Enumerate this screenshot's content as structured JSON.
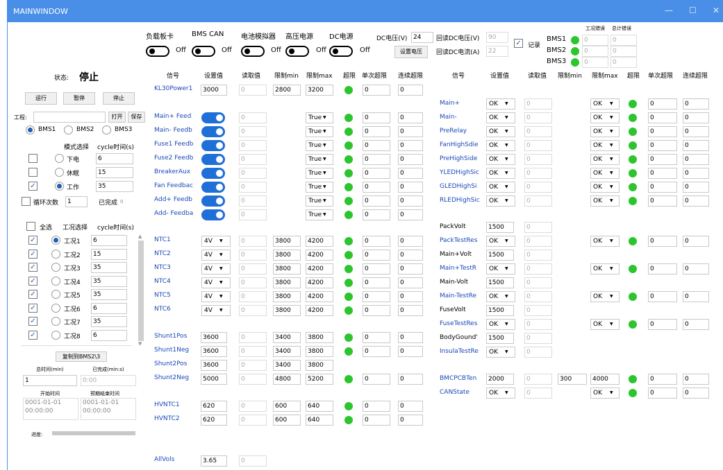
{
  "window": {
    "title": "MAINWINDOW"
  },
  "top": {
    "labels": [
      "负载板卡",
      "BMS CAN",
      "电池模拟器",
      "高压电源",
      "DC电源"
    ],
    "off": "Off",
    "dc_v_label": "DC电压(V)",
    "dc_v_value": "24",
    "set_btn": "设置电压",
    "rb_v_label": "回读DC电压(V)",
    "rb_v_value": "90",
    "rb_i_label": "回读DC电流(A)",
    "rb_i_value": "22",
    "record_label": "记录",
    "err_hdr1": "工况错误",
    "err_hdr2": "总计错误",
    "bms": [
      {
        "name": "BMS1",
        "a": "0",
        "b": "0"
      },
      {
        "name": "BMS2",
        "a": "0",
        "b": "0"
      },
      {
        "name": "BMS3",
        "a": "0",
        "b": "0"
      }
    ]
  },
  "left": {
    "status_label": "状态:",
    "status_value": "停止",
    "run": "运行",
    "pause": "暂停",
    "stop": "停止",
    "project_label": "工程:",
    "open": "打开",
    "save": "保存",
    "bms_options": [
      "BMS1",
      "BMS2",
      "BMS3"
    ],
    "mode_hdr": "模式选择",
    "cycle_hdr": "cycle时间(s)",
    "modes": [
      {
        "name": "下电",
        "val": "6"
      },
      {
        "name": "休眠",
        "val": "15"
      },
      {
        "name": "工作",
        "val": "35"
      }
    ],
    "loop_label": "循环次数",
    "loop_value": "1",
    "done_label": "已完成",
    "done_value": "0",
    "all_label": "全选",
    "cond_hdr": "工况选择",
    "cond_cycle_hdr": "cycle时间(s)",
    "conds": [
      {
        "name": "工况1",
        "val": "6"
      },
      {
        "name": "工况2",
        "val": "15"
      },
      {
        "name": "工况3",
        "val": "35"
      },
      {
        "name": "工况4",
        "val": "35"
      },
      {
        "name": "工况5",
        "val": "35"
      },
      {
        "name": "工况6",
        "val": "6"
      },
      {
        "name": "工况7",
        "val": "35"
      },
      {
        "name": "工况8",
        "val": "6"
      }
    ],
    "copy_btn": "复制到BMS2\\3",
    "total_time_label": "总时间(min)",
    "done_min_label": "已完成(min:s)",
    "total_time_value": "1",
    "done_min_value": "0:00",
    "start_label": "开始时间",
    "end_label": "预期结束时间",
    "start_value": "0001-01-01 00:00:00",
    "end_value": "0001-01-01 00:00:00",
    "progress_label": "进度:"
  },
  "mid": {
    "headers": [
      "信号",
      "设置值",
      "读取值",
      "限制min",
      "限制max",
      "超限",
      "单次超限",
      "连续超限"
    ],
    "kl30": {
      "name": "KL30Power1",
      "set": "3000",
      "read": "0",
      "min": "2800",
      "max": "3200",
      "a": "0",
      "b": "0"
    },
    "switches": [
      {
        "name": "Main+ Feed",
        "read": "0",
        "sel": "True",
        "a": "0",
        "b": "0"
      },
      {
        "name": "Main- Feedb",
        "read": "0",
        "sel": "True",
        "a": "0",
        "b": "0"
      },
      {
        "name": "Fuse1 Feedb",
        "read": "0",
        "sel": "True",
        "a": "0",
        "b": "0"
      },
      {
        "name": "Fuse2 Feedb",
        "read": "0",
        "sel": "True",
        "a": "0",
        "b": "0"
      },
      {
        "name": "BreakerAux",
        "read": "0",
        "sel": "True",
        "a": "0",
        "b": "0"
      },
      {
        "name": "Fan Feedbac",
        "read": "0",
        "sel": "True",
        "a": "0",
        "b": "0"
      },
      {
        "name": "Add+ Feedb",
        "read": "0",
        "sel": "True",
        "a": "0",
        "b": "0"
      },
      {
        "name": "Add- Feedba",
        "read": "0",
        "sel": "True",
        "a": "0",
        "b": "0"
      }
    ],
    "ntc": [
      {
        "name": "NTC1",
        "set": "4V",
        "read": "0",
        "min": "3800",
        "max": "4200",
        "a": "0",
        "b": "0"
      },
      {
        "name": "NTC2",
        "set": "4V",
        "read": "0",
        "min": "3800",
        "max": "4200",
        "a": "0",
        "b": "0"
      },
      {
        "name": "NTC3",
        "set": "4V",
        "read": "0",
        "min": "3800",
        "max": "4200",
        "a": "0",
        "b": "0"
      },
      {
        "name": "NTC4",
        "set": "4V",
        "read": "0",
        "min": "3800",
        "max": "4200",
        "a": "0",
        "b": "0"
      },
      {
        "name": "NTC5",
        "set": "4V",
        "read": "0",
        "min": "3800",
        "max": "4200",
        "a": "0",
        "b": "0"
      },
      {
        "name": "NTC6",
        "set": "4V",
        "read": "0",
        "min": "3800",
        "max": "4200",
        "a": "0",
        "b": "0"
      }
    ],
    "shunt": [
      {
        "name": "Shunt1Pos",
        "set": "3600",
        "read": "0",
        "min": "3400",
        "max": "3800",
        "a": "0",
        "b": "0"
      },
      {
        "name": "Shunt1Neg",
        "set": "3600",
        "read": "0",
        "min": "3400",
        "max": "3800",
        "a": "0",
        "b": "0"
      },
      {
        "name": "Shunt2Pos",
        "set": "3600",
        "read": "0",
        "min": "3400",
        "max": "3800"
      },
      {
        "name": "Shunt2Neg",
        "set": "5000",
        "read": "0",
        "min": "4800",
        "max": "5200",
        "a": "0",
        "b": "0"
      }
    ],
    "hvntc": [
      {
        "name": "HVNTC1",
        "set": "620",
        "read": "0",
        "min": "600",
        "max": "640",
        "a": "0",
        "b": "0"
      },
      {
        "name": "HVNTC2",
        "set": "620",
        "read": "0",
        "min": "600",
        "max": "640",
        "a": "0",
        "b": "0"
      }
    ],
    "allvols": {
      "name": "AllVols",
      "set": "3.65",
      "read": "0"
    }
  },
  "right": {
    "headers": [
      "信号",
      "设置值",
      "读取值",
      "限制min",
      "限制max",
      "超限",
      "单次超限",
      "连续超限"
    ],
    "rows": [
      {
        "name": "Main+",
        "set": "OK",
        "read": "0",
        "max": "OK",
        "a": "0",
        "b": "0"
      },
      {
        "name": "Main-",
        "set": "OK",
        "read": "0",
        "max": "OK",
        "a": "0",
        "b": "0"
      },
      {
        "name": "PreRelay",
        "set": "OK",
        "read": "0",
        "max": "OK",
        "a": "0",
        "b": "0"
      },
      {
        "name": "FanHighSdie",
        "set": "OK",
        "read": "0",
        "max": "OK",
        "a": "0",
        "b": "0"
      },
      {
        "name": "PreHighSide",
        "set": "OK",
        "read": "0",
        "max": "OK",
        "a": "0",
        "b": "0"
      },
      {
        "name": "YLEDHighSic",
        "set": "OK",
        "read": "0",
        "max": "OK",
        "a": "0",
        "b": "0"
      },
      {
        "name": "GLEDHighSi",
        "set": "OK",
        "read": "0",
        "max": "OK",
        "a": "0",
        "b": "0"
      },
      {
        "name": "RLEDHighSic",
        "set": "OK",
        "read": "0",
        "max": "OK",
        "a": "0",
        "b": "0"
      }
    ],
    "rows2": [
      {
        "name": "PackVolt",
        "set": "1500",
        "read": "0",
        "plain": true
      },
      {
        "name": "PackTestRes",
        "set": "OK",
        "read": "0",
        "max": "OK",
        "a": "0",
        "b": "0"
      },
      {
        "name": "Main+Volt",
        "set": "1500",
        "read": "0",
        "plain": true
      },
      {
        "name": "Main+TestR",
        "set": "OK",
        "read": "0",
        "max": "OK",
        "a": "0",
        "b": "0"
      },
      {
        "name": "Main-Volt",
        "set": "1500",
        "read": "0",
        "plain": true
      },
      {
        "name": "Main-TestRe",
        "set": "OK",
        "read": "0",
        "max": "OK",
        "a": "0",
        "b": "0"
      },
      {
        "name": "FuseVolt",
        "set": "1500",
        "read": "0",
        "plain": true
      },
      {
        "name": "FuseTestRes",
        "set": "OK",
        "read": "0",
        "max": "OK",
        "a": "0",
        "b": "0"
      },
      {
        "name": "BodyGound'",
        "set": "1500",
        "read": "0",
        "plain": true
      },
      {
        "name": "InsulaTestRe",
        "set": "OK",
        "read": "0",
        "noext": true
      }
    ],
    "bmcpcb": {
      "name": "BMCPCBTen",
      "set": "2000",
      "read": "0",
      "min": "300",
      "max": "4000",
      "a": "0",
      "b": "0"
    },
    "canstate": {
      "name": "CANState",
      "set": "OK",
      "read": "0",
      "max": "OK",
      "a": "0",
      "b": "0"
    }
  },
  "colors": {
    "titlebar": "#4a8fe7",
    "accent": "#1f6fd8",
    "ok": "#2dc52d",
    "link": "#1a48b8"
  }
}
